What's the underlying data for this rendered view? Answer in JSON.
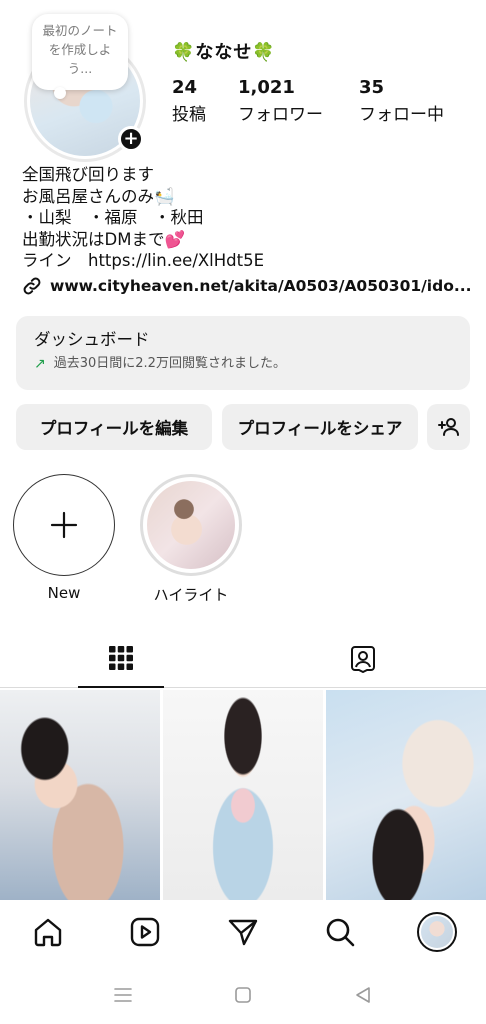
{
  "note": {
    "text": "最初のノートを作成しよう..."
  },
  "profile": {
    "username": "🍀ななせ🍀",
    "stats": [
      {
        "value": "24",
        "label": "投稿"
      },
      {
        "value": "1,021",
        "label": "フォロワー"
      },
      {
        "value": "35",
        "label": "フォロー中"
      }
    ],
    "bio_lines": [
      "全国飛び回ります",
      "お風呂屋さんのみ🛀",
      "・山梨　・福原　・秋田",
      "出勤状況はDMまで💕",
      "ライン　https://lin.ee/XlHdt5E"
    ],
    "link": "www.cityheaven.net/akita/A0503/A050301/ido..."
  },
  "dashboard": {
    "title": "ダッシュボード",
    "subtitle": "過去30日間に2.2万回閲覧されました。"
  },
  "buttons": {
    "edit": "プロフィールを編集",
    "share": "プロフィールをシェア"
  },
  "highlights": [
    {
      "label": "New"
    },
    {
      "label": "ハイライト"
    }
  ],
  "icons": {
    "note": "note-bubble",
    "add_story": "plus-badge-icon",
    "link": "link-icon",
    "trend": "trend-up-arrow-icon",
    "add_person": "add-person-icon",
    "grid_tab": "grid-icon",
    "tagged_tab": "tagged-person-icon",
    "home": "home-icon",
    "reels": "reels-icon",
    "send": "send-icon",
    "search": "search-icon",
    "profile": "avatar",
    "sys_menu": "menu-icon",
    "sys_home": "square-home-icon",
    "sys_back": "back-triangle-icon"
  },
  "colors": {
    "accent_text": "#111111",
    "button_bg": "#efefef",
    "dashboard_bg": "#f0f0f0",
    "trend_green": "#1e9e4a"
  }
}
